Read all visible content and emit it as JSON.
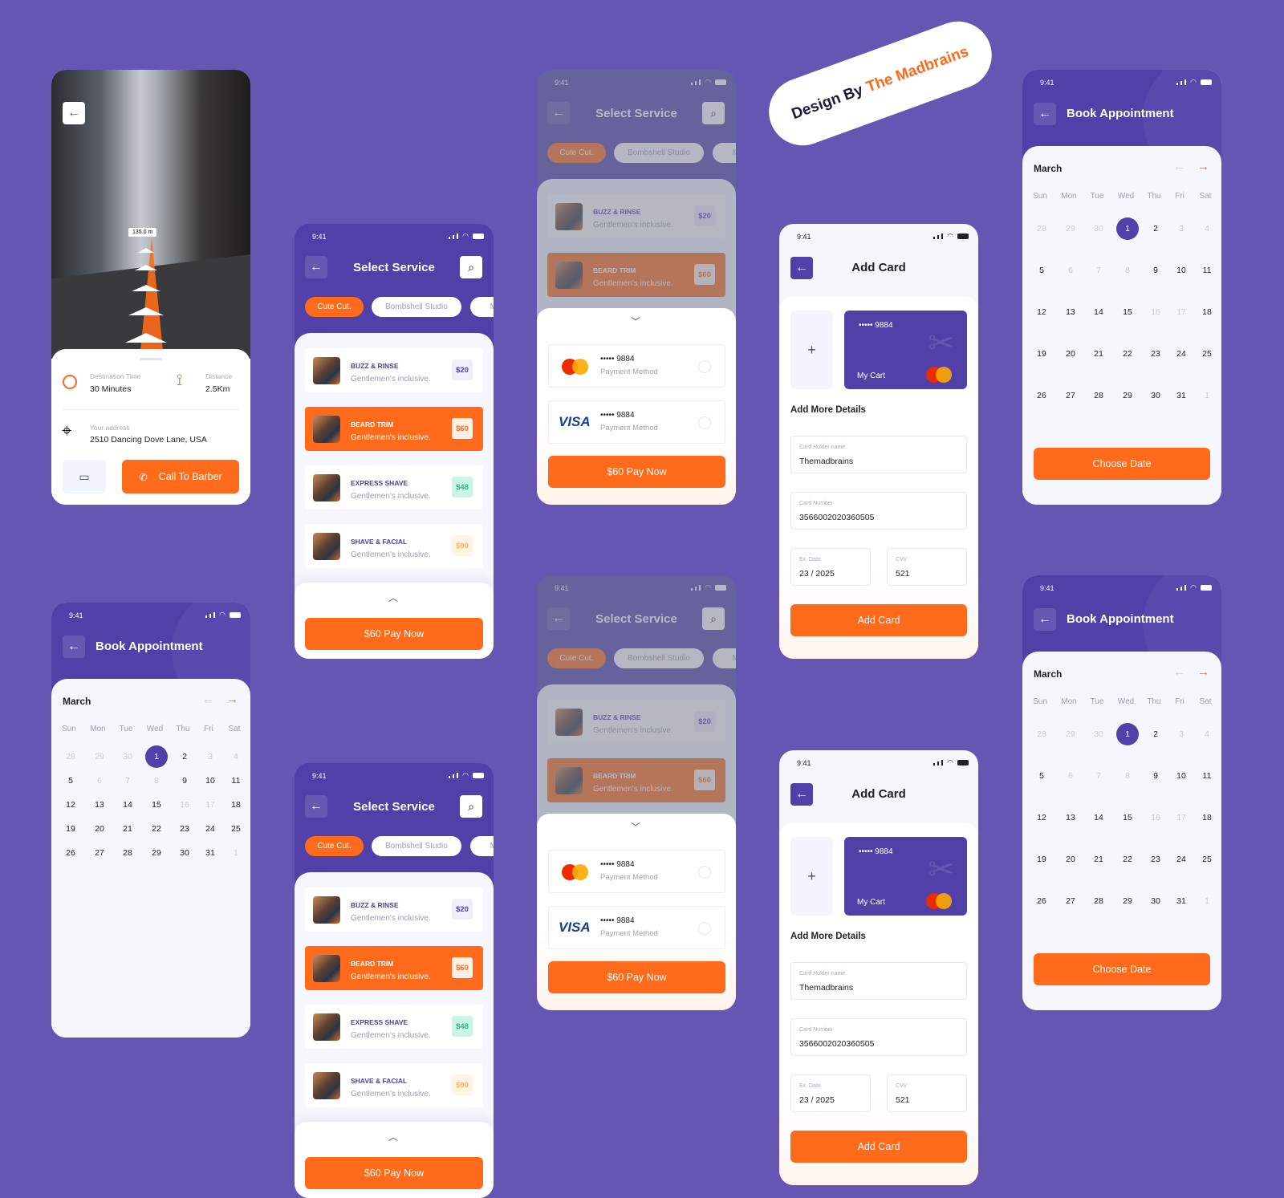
{
  "colors": {
    "background": "#6656b4",
    "primary": "#5040a8",
    "accent": "#ff6b1a"
  },
  "badge": {
    "text1": "Design By",
    "text2": "The Madbrains"
  },
  "status": {
    "time": "9:41"
  },
  "map": {
    "distance_tag": "135.0 m",
    "dest_label": "Destination Time",
    "dest_value": "30 Minutes",
    "dist_label": "Distance",
    "dist_value": "2.5Km",
    "addr_label": "Your address",
    "addr_value": "2510  Dancing Dove Lane, USA",
    "call": "Call To Barber",
    "icons": [
      "back-arrow-icon",
      "clock-icon",
      "route-icon",
      "location-target-icon",
      "chat-icon",
      "phone-icon"
    ]
  },
  "service": {
    "title": "Select Service",
    "chips": [
      "Cute Cut.",
      "Bombshell Studio",
      "Mi"
    ],
    "items": [
      {
        "name": "BUZZ & RINSE",
        "desc": "Gentlemen's inclusive.",
        "price": "$20",
        "price_bg": "#efeefb",
        "price_color": "#5040a8",
        "selected": false
      },
      {
        "name": "BEARD TRIM",
        "desc": "Gentlemen's inclusive.",
        "price": "$60",
        "price_bg": "#fff0e6",
        "price_color": "#ff6b1a",
        "selected": true
      },
      {
        "name": "EXPRESS SHAVE",
        "desc": "Gentlemen's inclusive.",
        "price": "$48",
        "price_bg": "#c9f5e4",
        "price_color": "#2fb582",
        "selected": false
      },
      {
        "name": "SHAVE & FACIAL",
        "desc": "Gentlemen's inclusive.",
        "price": "$90",
        "price_bg": "#fff3e3",
        "price_color": "#ffb54d",
        "selected": false
      }
    ],
    "pay": "$60 Pay Now"
  },
  "payment": {
    "methods": [
      {
        "type": "mastercard",
        "masked": "••••• 9884",
        "label": "Payment Method",
        "selected": false
      },
      {
        "type": "visa",
        "logo": "VISA",
        "masked": "••••• 9884",
        "label": "Payment Method",
        "selected": false
      }
    ],
    "pay": "$60 Pay Now"
  },
  "add_card": {
    "title": "Add Card",
    "card_masked": "••••• 9884",
    "card_label": "My Cart",
    "plus": "+",
    "section": "Add More Details",
    "holder_label": "Card Holder name",
    "holder_value": "Themadbrains",
    "number_label": "Card Number",
    "number_value": "3566002020360505",
    "exp_label": "Ex. Date",
    "exp_value": "23 / 2025",
    "cvv_label": "CVV",
    "cvv_value": "521",
    "button": "Add Card"
  },
  "calendar": {
    "title": "Book Appointment",
    "month": "March",
    "weekdays": [
      "Sun",
      "Mon",
      "Tue",
      "Wed",
      "Thu",
      "Fri",
      "Sat"
    ],
    "weeks": [
      [
        {
          "d": "28",
          "m": true
        },
        {
          "d": "29",
          "m": true
        },
        {
          "d": "30",
          "m": true
        },
        {
          "d": "1",
          "s": true
        },
        {
          "d": "2"
        },
        {
          "d": "3",
          "m": true
        },
        {
          "d": "4",
          "m": true
        }
      ],
      [
        {
          "d": "5"
        },
        {
          "d": "6",
          "m": true
        },
        {
          "d": "7",
          "m": true
        },
        {
          "d": "8",
          "m": true
        },
        {
          "d": "9"
        },
        {
          "d": "10"
        },
        {
          "d": "11"
        }
      ],
      [
        {
          "d": "12"
        },
        {
          "d": "13"
        },
        {
          "d": "14"
        },
        {
          "d": "15"
        },
        {
          "d": "16",
          "m": true
        },
        {
          "d": "17",
          "m": true
        },
        {
          "d": "18"
        }
      ],
      [
        {
          "d": "19"
        },
        {
          "d": "20"
        },
        {
          "d": "21"
        },
        {
          "d": "22"
        },
        {
          "d": "23"
        },
        {
          "d": "24"
        },
        {
          "d": "25"
        }
      ],
      [
        {
          "d": "26"
        },
        {
          "d": "27"
        },
        {
          "d": "28"
        },
        {
          "d": "29"
        },
        {
          "d": "30"
        },
        {
          "d": "31"
        },
        {
          "d": "1",
          "m": true
        }
      ]
    ],
    "selected_day": "1",
    "button": "Choose Date"
  }
}
